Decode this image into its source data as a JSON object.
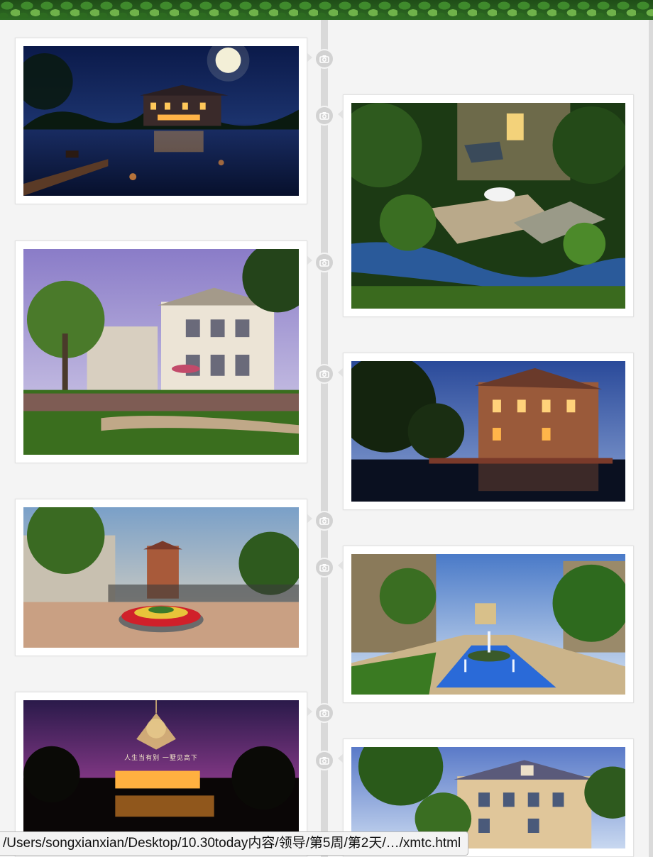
{
  "status_bar": {
    "url": "/Users/songxianxian/Desktop/10.30today内容/领导/第5周/第2天/…/xmtc.html"
  },
  "timeline": {
    "icon": "camera-icon",
    "items": [
      {
        "side": "left",
        "subject": "night lakeside villa under full moon"
      },
      {
        "side": "right",
        "subject": "villa garden with stream at dusk"
      },
      {
        "side": "left",
        "subject": "classical villa with garden"
      },
      {
        "side": "right",
        "subject": "brick villa reflecting in pond at dusk"
      },
      {
        "side": "left",
        "subject": "gated entrance with flower roundabout"
      },
      {
        "side": "right",
        "subject": "courtyard fountain between apartments"
      },
      {
        "side": "left",
        "subject": "chandelier night advertisement",
        "caption": "人生当有别  一墅见高下"
      },
      {
        "side": "right",
        "subject": "grand villa under blue sky"
      }
    ]
  },
  "colors": {
    "spine": "#d9d9d9",
    "card_border": "#e2e2e2",
    "page_background": "#f4f4f4"
  }
}
